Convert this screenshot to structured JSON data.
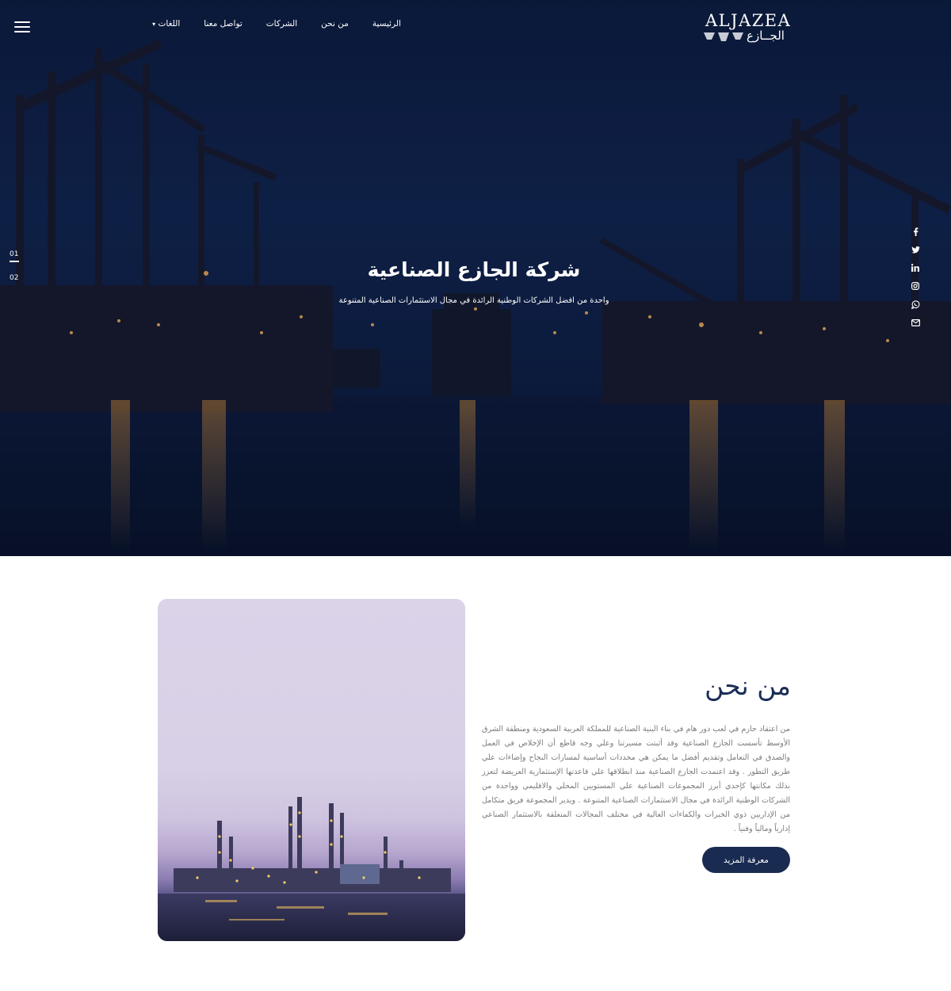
{
  "header": {
    "logo": {
      "latin": "ALJAZEA",
      "arabic": "الجــازع"
    },
    "menu_icon": "hamburger-icon",
    "nav": [
      {
        "label": "الرئيسية"
      },
      {
        "label": "من نحن"
      },
      {
        "label": "الشركات"
      },
      {
        "label": "تواصل معنا"
      },
      {
        "label": "اللغات",
        "icon": "chevron-down-icon"
      }
    ]
  },
  "hero": {
    "title": "شركة الجازع الصناعية",
    "subtitle": "واحدة من افضل الشركات الوطنية الرائدة في مجال الاستثمارات الصناعية المتنوعة",
    "slides": [
      {
        "label": "01",
        "active": true
      },
      {
        "label": "02",
        "active": false
      }
    ],
    "social": [
      "facebook-icon",
      "twitter-icon",
      "linkedin-icon",
      "instagram-icon",
      "whatsapp-icon",
      "envelope-icon"
    ]
  },
  "about": {
    "title": "من نحن",
    "text": "من اعتقاد حازم في لعب دور هام في بناء البنية الصناعية للمملكة العربية السعودية ومنطقة الشرق الأوسط تأسست الجازع الصناعية وقد أثبتت مسيرتنا وعلي وجه قاطع أن الإخلاص في العمل والصدق في التعامل وتقديم أفضل ما يمكن هي محددات أساسية لمسارات النجاح وإضاءات علي طريق التطور . وقد اعتمدت الجازع الصناعية منذ انطلاقها علي قاعدتها الإستثمارية العريضة لتعزز بذلك مكانتها كإحدي أبرز المجموعات الصناعية علي المستويين المحلي والاقليمي وواحدة من الشركات الوطنية الرائدة في مجال الاستثمارات الصناعية المتنوعة . ويدير المجموعة فريق متكامل من الإداريين ذوي الخبرات والكفاءات العالية في مختلف المجالات المتعلقة بالاستثمار الصناعي إدارياً ومالياً وفنياً .",
    "button": "معرفة المزيد"
  },
  "colors": {
    "navy": "#1a2b52",
    "hero_bg": "#0f2149",
    "text_gray": "#7a7a7a"
  }
}
